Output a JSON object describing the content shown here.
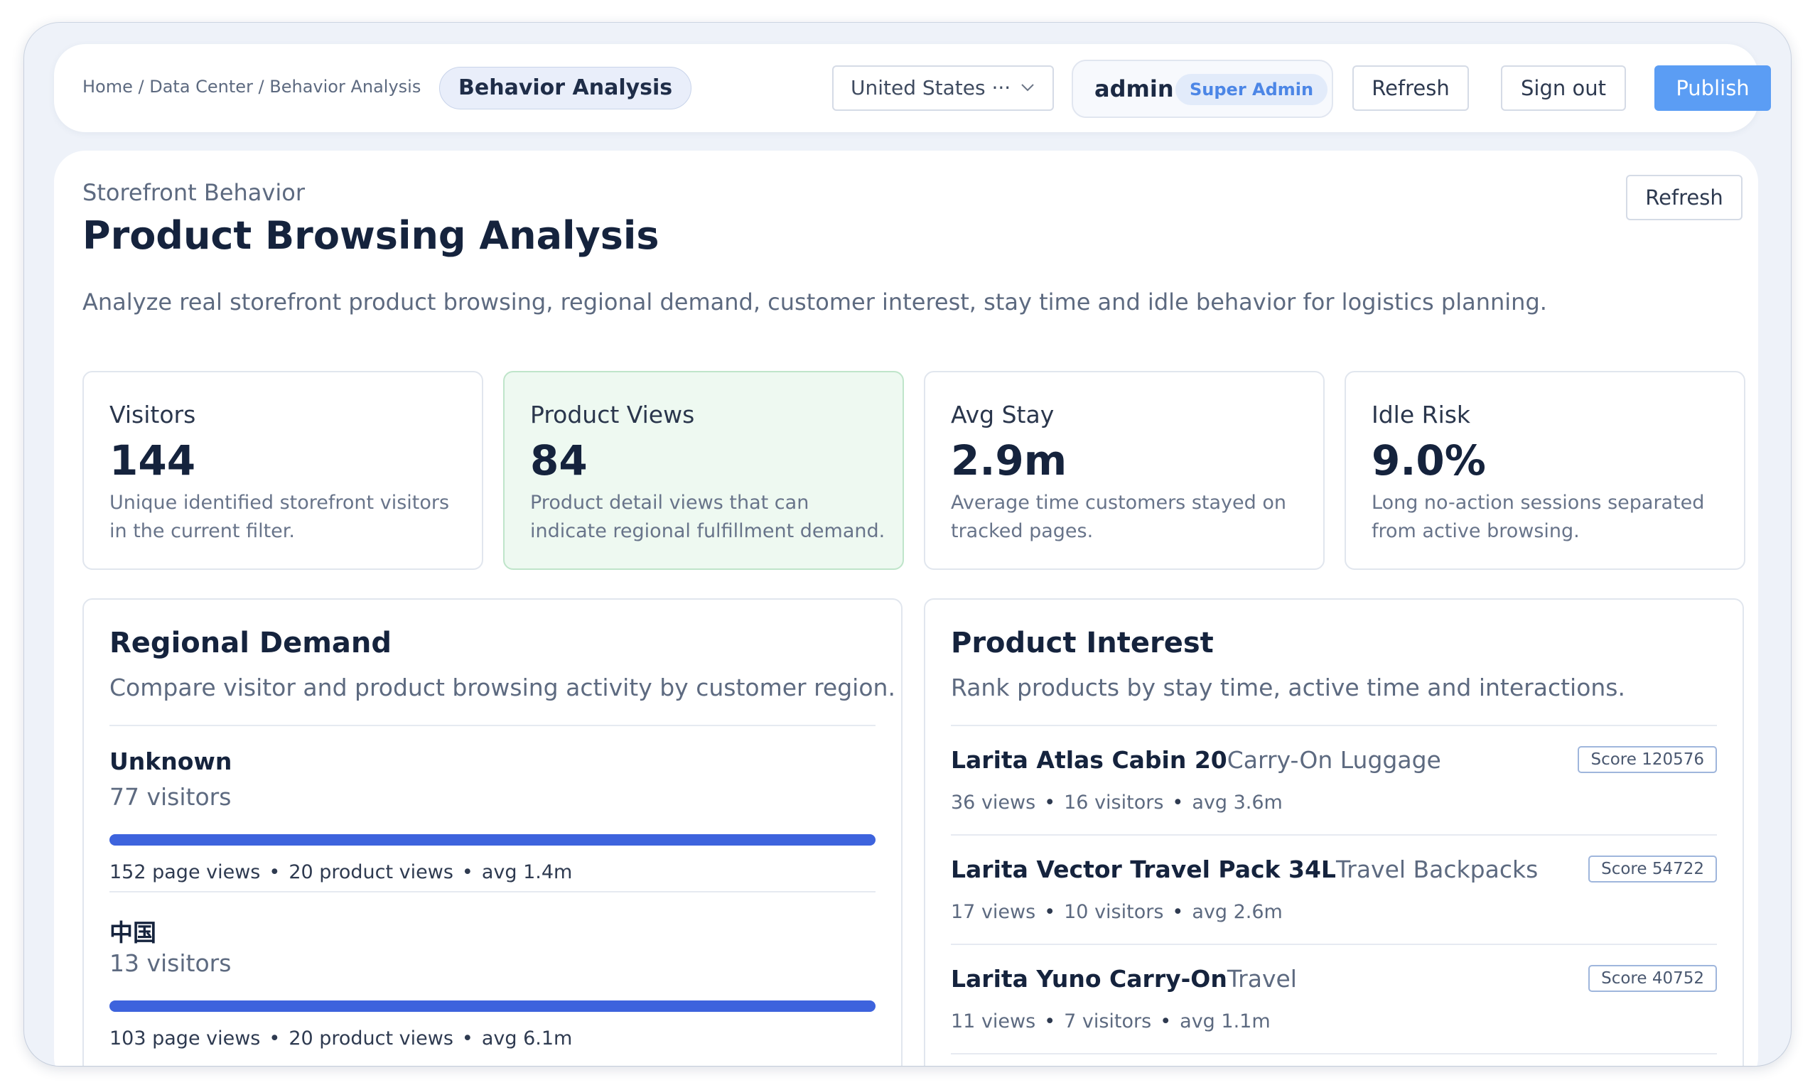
{
  "header": {
    "breadcrumb": "Home / Data Center / Behavior Analysis",
    "current_page_pill": "Behavior Analysis",
    "country_select": "United States ···",
    "user_name": "admin",
    "user_role": "Super Admin",
    "refresh_label": "Refresh",
    "signout_label": "Sign out",
    "publish_label": "Publish"
  },
  "page": {
    "eyebrow": "Storefront Behavior",
    "title": "Product Browsing Analysis",
    "description": "Analyze real storefront product browsing, regional demand, customer interest, stay time and idle behavior for logistics planning.",
    "refresh_label": "Refresh"
  },
  "stats": [
    {
      "label": "Visitors",
      "value": "144",
      "desc": "Unique identified storefront visitors in the current filter."
    },
    {
      "label": "Product Views",
      "value": "84",
      "desc": "Product detail views that can indicate regional fulfillment demand."
    },
    {
      "label": "Avg Stay",
      "value": "2.9m",
      "desc": "Average time customers stayed on tracked pages."
    },
    {
      "label": "Idle Risk",
      "value": "9.0%",
      "desc": "Long no-action sessions separated from active browsing."
    }
  ],
  "regional": {
    "title": "Regional Demand",
    "subtitle": "Compare visitor and product browsing activity by customer region.",
    "items": [
      {
        "name": "Unknown",
        "visitors": "77 visitors",
        "page_views": "152 page views",
        "product_views": "20 product views",
        "avg": "avg 1.4m",
        "bar_fraction": 1.0
      },
      {
        "name": "中国",
        "visitors": "13 visitors",
        "page_views": "103 page views",
        "product_views": "20 product views",
        "avg": "avg 6.1m",
        "bar_fraction": 1.0
      }
    ]
  },
  "interest": {
    "title": "Product Interest",
    "subtitle": "Rank products by stay time, active time and interactions.",
    "items": [
      {
        "name": "Larita Atlas Cabin 20",
        "category": "Carry-On Luggage",
        "score": "Score 120576",
        "views": "36 views",
        "visitors": "16 visitors",
        "avg": "avg 3.6m"
      },
      {
        "name": "Larita Vector Travel Pack 34L",
        "category": "Travel Backpacks",
        "score": "Score 54722",
        "views": "17 views",
        "visitors": "10 visitors",
        "avg": "avg 2.6m"
      },
      {
        "name": "Larita Yuno Carry-On",
        "category": "Travel",
        "score": "Score 40752",
        "views": "11 views",
        "visitors": "7 visitors",
        "avg": "avg 1.1m"
      }
    ]
  },
  "separator": "•",
  "colors": {
    "primary": "#5b9df4",
    "bar": "#3d63dd",
    "highlight_card": "#eef9f1",
    "role_badge_text": "#4c86e6"
  }
}
